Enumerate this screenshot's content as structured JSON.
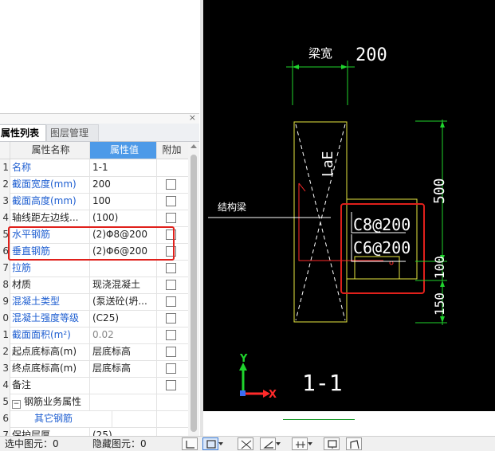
{
  "panel": {
    "close_glyph": "×",
    "tabs": [
      {
        "label": "属性列表",
        "active": true
      },
      {
        "label": "图层管理",
        "active": false
      }
    ]
  },
  "table": {
    "headers": {
      "name": "属性名称",
      "value": "属性值",
      "add": "附加"
    },
    "rows": [
      {
        "num": "1",
        "name": "名称",
        "value": "1-1",
        "checkbox": false
      },
      {
        "num": "2",
        "name": "截面宽度(mm)",
        "value": "200",
        "checkbox": true
      },
      {
        "num": "3",
        "name": "截面高度(mm)",
        "value": "100",
        "checkbox": true
      },
      {
        "num": "4",
        "name": "轴线距左边线...",
        "value": "(100)",
        "checkbox": true
      },
      {
        "num": "5",
        "name": "水平钢筋",
        "value": "(2)Φ8@200",
        "checkbox": true
      },
      {
        "num": "6",
        "name": "垂直钢筋",
        "value": "(2)Φ6@200",
        "checkbox": true
      },
      {
        "num": "7",
        "name": "拉筋",
        "value": "",
        "checkbox": true
      },
      {
        "num": "8",
        "name": "材质",
        "value": "现浇混凝土",
        "checkbox": true
      },
      {
        "num": "9",
        "name": "混凝土类型",
        "value": "(泵送砼(坍...",
        "checkbox": true
      },
      {
        "num": "0",
        "name": "混凝土强度等级",
        "value": "(C25)",
        "checkbox": true
      },
      {
        "num": "1",
        "name": "截面面积(m²)",
        "value": "0.02",
        "checkbox": true
      },
      {
        "num": "2",
        "name": "起点底标高(m)",
        "value": "层底标高",
        "checkbox": true
      },
      {
        "num": "3",
        "name": "终点底标高(m)",
        "value": "层底标高",
        "checkbox": true
      },
      {
        "num": "4",
        "name": "备注",
        "value": "",
        "checkbox": true
      },
      {
        "num": "5",
        "name": "钢筋业务属性",
        "value": "",
        "checkbox": false,
        "group": true,
        "expander": "−"
      },
      {
        "num": "6",
        "name": "其它钢筋",
        "value": "",
        "checkbox": false
      },
      {
        "num": "7",
        "name": "保护层厚...",
        "value": "(25)",
        "checkbox": false
      }
    ]
  },
  "cad": {
    "dim_label_width": "梁宽",
    "dim_width": "200",
    "label_lae": "LaE",
    "label_beam": "结构梁",
    "rebar_1": "C8@200",
    "rebar_2": "C6@200",
    "dim_500": "500",
    "dim_100": "100",
    "dim_150": "150",
    "section_label": "1-1",
    "axis_y": "Y",
    "axis_x": "X",
    "colors": {
      "green": "#1fd42d",
      "yellow": "#e6e640",
      "red": "#ff2a2a",
      "white": "#ffffff",
      "highlight": "#e0201b"
    }
  },
  "status": {
    "selected_label": "选中图元：0",
    "hidden_label": "隐藏图元：0"
  }
}
